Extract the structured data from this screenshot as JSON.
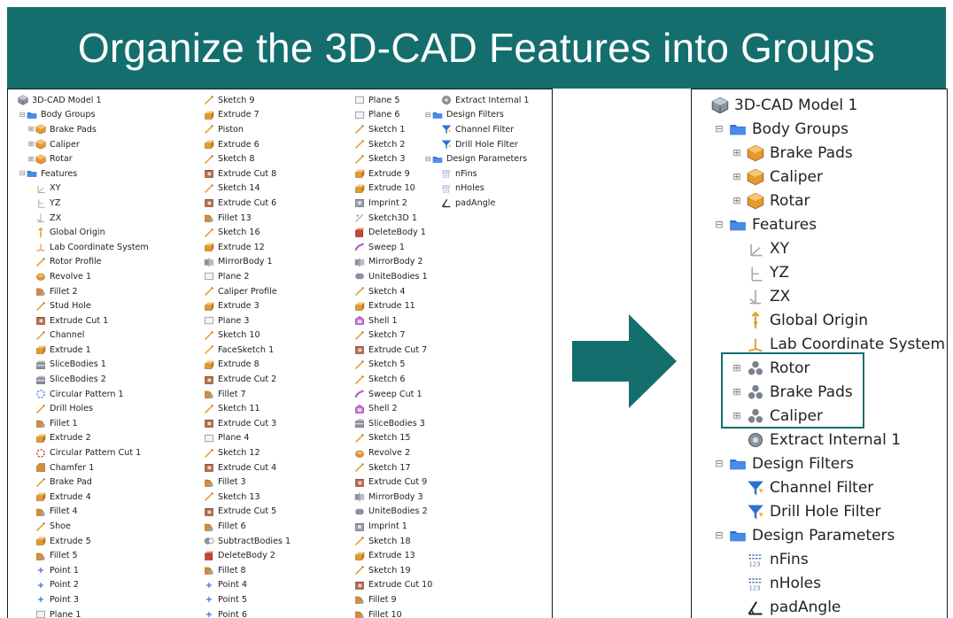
{
  "title": "Organize the 3D-CAD Features into Groups",
  "colors": {
    "banner": "#146e6e",
    "highlight": "#146e6e"
  },
  "before_tree": {
    "columns": [
      [
        {
          "label": "3D-CAD Model 1",
          "icon": "model-icon",
          "indent": 0
        },
        {
          "label": "Body Groups",
          "icon": "folder-icon",
          "indent": 1,
          "expander": "minus"
        },
        {
          "label": "Brake Pads",
          "icon": "body-icon",
          "indent": 2,
          "expander": "plus"
        },
        {
          "label": "Caliper",
          "icon": "body-icon",
          "indent": 2,
          "expander": "plus"
        },
        {
          "label": "Rotar",
          "icon": "body-icon",
          "indent": 2,
          "expander": "plus"
        },
        {
          "label": "Features",
          "icon": "folder-icon",
          "indent": 1,
          "expander": "minus"
        },
        {
          "label": "XY",
          "icon": "plane-xy-icon",
          "indent": 2
        },
        {
          "label": "YZ",
          "icon": "plane-yz-icon",
          "indent": 2
        },
        {
          "label": "ZX",
          "icon": "plane-zx-icon",
          "indent": 2
        },
        {
          "label": "Global Origin",
          "icon": "origin-icon",
          "indent": 2
        },
        {
          "label": "Lab Coordinate System",
          "icon": "coordinate-system-icon",
          "indent": 2
        },
        {
          "label": "Rotor Profile",
          "icon": "sketch-icon",
          "indent": 2
        },
        {
          "label": "Revolve 1",
          "icon": "revolve-icon",
          "indent": 2
        },
        {
          "label": "Fillet 2",
          "icon": "fillet-icon",
          "indent": 2
        },
        {
          "label": "Stud Hole",
          "icon": "sketch-icon",
          "indent": 2
        },
        {
          "label": "Extrude Cut 1",
          "icon": "extrude-cut-icon",
          "indent": 2
        },
        {
          "label": "Channel",
          "icon": "sketch-icon",
          "indent": 2
        },
        {
          "label": "Extrude 1",
          "icon": "extrude-icon",
          "indent": 2
        },
        {
          "label": "SliceBodies 1",
          "icon": "slice-icon",
          "indent": 2
        },
        {
          "label": "SliceBodies 2",
          "icon": "slice-icon",
          "indent": 2
        },
        {
          "label": "Circular Pattern 1",
          "icon": "circular-pattern-icon",
          "indent": 2
        },
        {
          "label": "Drill Holes",
          "icon": "sketch-icon",
          "indent": 2
        },
        {
          "label": "Fillet 1",
          "icon": "fillet-icon",
          "indent": 2
        },
        {
          "label": "Extrude 2",
          "icon": "extrude-icon",
          "indent": 2
        },
        {
          "label": "Circular Pattern Cut 1",
          "icon": "circular-pattern-cut-icon",
          "indent": 2
        },
        {
          "label": "Chamfer 1",
          "icon": "chamfer-icon",
          "indent": 2
        },
        {
          "label": "Brake Pad",
          "icon": "sketch-icon",
          "indent": 2
        },
        {
          "label": "Extrude 4",
          "icon": "extrude-icon",
          "indent": 2
        },
        {
          "label": "Fillet 4",
          "icon": "fillet-icon",
          "indent": 2
        },
        {
          "label": "Shoe",
          "icon": "sketch-icon",
          "indent": 2
        },
        {
          "label": "Extrude 5",
          "icon": "extrude-icon",
          "indent": 2
        },
        {
          "label": "Fillet 5",
          "icon": "fillet-icon",
          "indent": 2
        },
        {
          "label": "Point 1",
          "icon": "point-icon",
          "indent": 2
        },
        {
          "label": "Point 2",
          "icon": "point-icon",
          "indent": 2
        },
        {
          "label": "Point 3",
          "icon": "point-icon",
          "indent": 2
        },
        {
          "label": "Plane 1",
          "icon": "plane-icon",
          "indent": 2
        }
      ],
      [
        {
          "label": "Sketch 9",
          "icon": "sketch-icon"
        },
        {
          "label": "Extrude 7",
          "icon": "extrude-icon"
        },
        {
          "label": "Piston",
          "icon": "sketch-icon"
        },
        {
          "label": "Extrude 6",
          "icon": "extrude-icon"
        },
        {
          "label": "Sketch 8",
          "icon": "sketch-icon"
        },
        {
          "label": "Extrude Cut 8",
          "icon": "extrude-cut-icon"
        },
        {
          "label": "Sketch 14",
          "icon": "sketch-icon"
        },
        {
          "label": "Extrude Cut 6",
          "icon": "extrude-cut-icon"
        },
        {
          "label": "Fillet 13",
          "icon": "fillet-icon"
        },
        {
          "label": "Sketch 16",
          "icon": "sketch-icon"
        },
        {
          "label": "Extrude 12",
          "icon": "extrude-icon"
        },
        {
          "label": "MirrorBody 1",
          "icon": "mirror-icon"
        },
        {
          "label": "Plane 2",
          "icon": "plane-icon"
        },
        {
          "label": "Caliper Profile",
          "icon": "sketch-icon"
        },
        {
          "label": "Extrude 3",
          "icon": "extrude-icon"
        },
        {
          "label": "Plane 3",
          "icon": "plane-icon"
        },
        {
          "label": "Sketch 10",
          "icon": "sketch-icon"
        },
        {
          "label": "FaceSketch 1",
          "icon": "sketch-icon"
        },
        {
          "label": "Extrude 8",
          "icon": "extrude-icon"
        },
        {
          "label": "Extrude Cut 2",
          "icon": "extrude-cut-icon"
        },
        {
          "label": "Fillet 7",
          "icon": "fillet-icon"
        },
        {
          "label": "Sketch 11",
          "icon": "sketch-icon"
        },
        {
          "label": "Extrude Cut 3",
          "icon": "extrude-cut-icon"
        },
        {
          "label": "Plane 4",
          "icon": "plane-icon"
        },
        {
          "label": "Sketch 12",
          "icon": "sketch-icon"
        },
        {
          "label": "Extrude Cut 4",
          "icon": "extrude-cut-icon"
        },
        {
          "label": "Fillet 3",
          "icon": "fillet-icon"
        },
        {
          "label": "Sketch 13",
          "icon": "sketch-icon"
        },
        {
          "label": "Extrude Cut 5",
          "icon": "extrude-cut-icon"
        },
        {
          "label": "Fillet 6",
          "icon": "fillet-icon"
        },
        {
          "label": "SubtractBodies 1",
          "icon": "subtract-icon"
        },
        {
          "label": "DeleteBody 2",
          "icon": "delete-body-icon"
        },
        {
          "label": "Fillet 8",
          "icon": "fillet-icon"
        },
        {
          "label": "Point 4",
          "icon": "point-icon"
        },
        {
          "label": "Point 5",
          "icon": "point-icon"
        },
        {
          "label": "Point 6",
          "icon": "point-icon"
        }
      ],
      [
        {
          "label": "Plane 5",
          "icon": "plane-icon"
        },
        {
          "label": "Plane 6",
          "icon": "plane-icon"
        },
        {
          "label": "Sketch 1",
          "icon": "sketch-icon"
        },
        {
          "label": "Sketch 2",
          "icon": "sketch-icon"
        },
        {
          "label": "Sketch 3",
          "icon": "sketch-icon"
        },
        {
          "label": "Extrude 9",
          "icon": "extrude-icon"
        },
        {
          "label": "Extrude 10",
          "icon": "extrude-icon"
        },
        {
          "label": "Imprint 2",
          "icon": "imprint-icon"
        },
        {
          "label": "Sketch3D 1",
          "icon": "sketch3d-icon"
        },
        {
          "label": "DeleteBody 1",
          "icon": "delete-body-icon"
        },
        {
          "label": "Sweep 1",
          "icon": "sweep-icon"
        },
        {
          "label": "MirrorBody 2",
          "icon": "mirror-icon"
        },
        {
          "label": "UniteBodies 1",
          "icon": "unite-icon"
        },
        {
          "label": "Sketch 4",
          "icon": "sketch-icon"
        },
        {
          "label": "Extrude 11",
          "icon": "extrude-icon"
        },
        {
          "label": "Shell 1",
          "icon": "shell-icon"
        },
        {
          "label": "Sketch 7",
          "icon": "sketch-icon"
        },
        {
          "label": "Extrude Cut 7",
          "icon": "extrude-cut-icon"
        },
        {
          "label": "Sketch 5",
          "icon": "sketch-icon"
        },
        {
          "label": "Sketch 6",
          "icon": "sketch-icon"
        },
        {
          "label": "Sweep Cut 1",
          "icon": "sweep-icon"
        },
        {
          "label": "Shell 2",
          "icon": "shell-icon"
        },
        {
          "label": "SliceBodies 3",
          "icon": "slice-icon"
        },
        {
          "label": "Sketch 15",
          "icon": "sketch-icon"
        },
        {
          "label": "Revolve 2",
          "icon": "revolve-icon"
        },
        {
          "label": "Sketch 17",
          "icon": "sketch-icon"
        },
        {
          "label": "Extrude Cut 9",
          "icon": "extrude-cut-icon"
        },
        {
          "label": "MirrorBody 3",
          "icon": "mirror-icon"
        },
        {
          "label": "UniteBodies 2",
          "icon": "unite-icon"
        },
        {
          "label": "Imprint 1",
          "icon": "imprint-icon"
        },
        {
          "label": "Sketch 18",
          "icon": "sketch-icon"
        },
        {
          "label": "Extrude 13",
          "icon": "extrude-icon"
        },
        {
          "label": "Sketch 19",
          "icon": "sketch-icon"
        },
        {
          "label": "Extrude Cut 10",
          "icon": "extrude-cut-icon"
        },
        {
          "label": "Fillet 9",
          "icon": "fillet-icon"
        },
        {
          "label": "Fillet 10",
          "icon": "fillet-icon"
        }
      ],
      [
        {
          "label": "Extract Internal 1",
          "icon": "extract-icon",
          "indent": 1
        },
        {
          "label": "Design Filters",
          "icon": "folder-icon",
          "indent": 0,
          "expander": "minus"
        },
        {
          "label": "Channel Filter",
          "icon": "filter-icon",
          "indent": 1
        },
        {
          "label": "Drill Hole Filter",
          "icon": "filter-icon",
          "indent": 1
        },
        {
          "label": "Design Parameters",
          "icon": "folder-icon",
          "indent": 0,
          "expander": "minus"
        },
        {
          "label": "nFins",
          "icon": "parameter-icon",
          "indent": 1
        },
        {
          "label": "nHoles",
          "icon": "parameter-icon",
          "indent": 1
        },
        {
          "label": "padAngle",
          "icon": "angle-parameter-icon",
          "indent": 1
        }
      ]
    ]
  },
  "after_tree": {
    "items": [
      {
        "label": "3D-CAD Model 1",
        "icon": "model-icon",
        "indent": 0
      },
      {
        "label": "Body Groups",
        "icon": "folder-icon",
        "indent": 1,
        "expander": "minus"
      },
      {
        "label": "Brake Pads",
        "icon": "body-icon",
        "indent": 2,
        "expander": "plus"
      },
      {
        "label": "Caliper",
        "icon": "body-icon",
        "indent": 2,
        "expander": "plus"
      },
      {
        "label": "Rotar",
        "icon": "body-icon",
        "indent": 2,
        "expander": "plus"
      },
      {
        "label": "Features",
        "icon": "folder-icon",
        "indent": 1,
        "expander": "minus"
      },
      {
        "label": "XY",
        "icon": "plane-xy-icon",
        "indent": 2
      },
      {
        "label": "YZ",
        "icon": "plane-yz-icon",
        "indent": 2
      },
      {
        "label": "ZX",
        "icon": "plane-zx-icon",
        "indent": 2
      },
      {
        "label": "Global Origin",
        "icon": "origin-icon",
        "indent": 2
      },
      {
        "label": "Lab Coordinate System",
        "icon": "coordinate-system-icon",
        "indent": 2
      },
      {
        "label": "Rotor",
        "icon": "feature-group-icon",
        "indent": 2,
        "expander": "plus"
      },
      {
        "label": "Brake Pads",
        "icon": "feature-group-icon",
        "indent": 2,
        "expander": "plus"
      },
      {
        "label": "Caliper",
        "icon": "feature-group-icon",
        "indent": 2,
        "expander": "plus"
      },
      {
        "label": "Extract Internal 1",
        "icon": "extract-icon",
        "indent": 2
      },
      {
        "label": "Design Filters",
        "icon": "folder-icon",
        "indent": 1,
        "expander": "minus"
      },
      {
        "label": "Channel Filter",
        "icon": "filter-icon",
        "indent": 2
      },
      {
        "label": "Drill Hole Filter",
        "icon": "filter-icon",
        "indent": 2
      },
      {
        "label": "Design Parameters",
        "icon": "folder-icon",
        "indent": 1,
        "expander": "minus"
      },
      {
        "label": "nFins",
        "icon": "parameter-icon",
        "indent": 2
      },
      {
        "label": "nHoles",
        "icon": "parameter-icon",
        "indent": 2
      },
      {
        "label": "padAngle",
        "icon": "angle-parameter-icon",
        "indent": 2
      }
    ]
  }
}
